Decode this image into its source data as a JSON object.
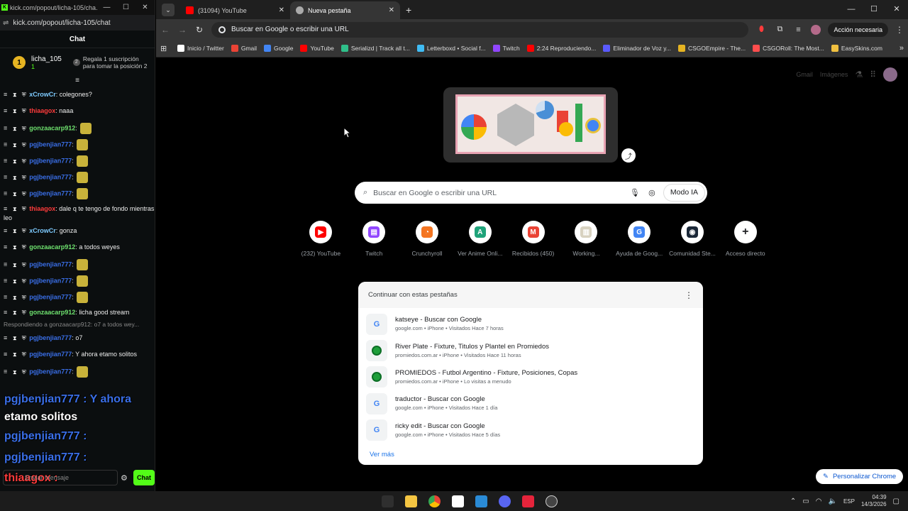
{
  "chat_window": {
    "title_url": "kick.com/popout/licha-105/cha...",
    "address": "kick.com/popout/licha-105/chat",
    "heading": "Chat",
    "pinned": {
      "rank": "1",
      "user": "licha_105",
      "count": "1",
      "gift_text_1": "Regala 1 suscripción",
      "gift_text_2": "para tomar la posición 2"
    },
    "messages": [
      {
        "user": "xCrowCr",
        "color": "#7ecbff",
        "text": "colegones?"
      },
      {
        "user": "thiaagox",
        "color": "#ff3b3b",
        "text": "naaa"
      },
      {
        "user": "gonzaacarp912",
        "color": "#6fe36f",
        "text": ""
      },
      {
        "user": "pgjbenjian777",
        "color": "#3a6fe8",
        "text": ""
      },
      {
        "user": "pgjbenjian777",
        "color": "#3a6fe8",
        "text": ""
      },
      {
        "user": "pgjbenjian777",
        "color": "#3a6fe8",
        "text": ""
      },
      {
        "user": "pgjbenjian777",
        "color": "#3a6fe8",
        "text": ""
      },
      {
        "user": "thiaagox",
        "color": "#ff3b3b",
        "text": "dale q te tengo de fondo mientras leo"
      },
      {
        "user": "xCrowCr",
        "color": "#7ecbff",
        "text": "gonza"
      },
      {
        "user": "gonzaacarp912",
        "color": "#6fe36f",
        "text": "a todos weyes"
      },
      {
        "user": "pgjbenjian777",
        "color": "#3a6fe8",
        "text": ""
      },
      {
        "user": "pgjbenjian777",
        "color": "#3a6fe8",
        "text": ""
      },
      {
        "user": "pgjbenjian777",
        "color": "#3a6fe8",
        "text": ""
      },
      {
        "user": "gonzaacarp912",
        "color": "#6fe36f",
        "text": "licha good stream"
      }
    ],
    "reply_note": "Respondiendo a gonzaacarp912: o7 a todos wey...",
    "messages_after": [
      {
        "user": "pgjbenjian777",
        "color": "#3a6fe8",
        "text": "o7"
      },
      {
        "user": "pgjbenjian777",
        "color": "#3a6fe8",
        "text": "Y ahora etamo solitos"
      },
      {
        "user": "pgjbenjian777",
        "color": "#3a6fe8",
        "text": ""
      }
    ],
    "overlay_1": "pgjbenjian777 : Y ahora",
    "overlay_2": "etamo solitos",
    "overlay_3": "pgjbenjian777 :",
    "overlay_4": "pgjbenjian777 :",
    "overlay_5": "thiaagox :",
    "input_placeholder": "Enviar mensaje",
    "send_label": "Chat"
  },
  "chrome": {
    "tabs": [
      {
        "title": "(31094) YouTube",
        "icon": "youtube-icon"
      },
      {
        "title": "Nueva pestaña",
        "icon": "chrome-icon"
      }
    ],
    "omnibox_text": "Buscar en Google o escribir una URL",
    "action_button": "Acción necesaria",
    "bookmarks": [
      {
        "label": "Inicio / Twitter",
        "color": "#ffffff"
      },
      {
        "label": "Gmail",
        "color": "#ea4335"
      },
      {
        "label": "Google",
        "color": "#4285f4"
      },
      {
        "label": "YouTube",
        "color": "#ff0000"
      },
      {
        "label": "Serializd | Track all t...",
        "color": "#2fbf8a"
      },
      {
        "label": "Letterboxd • Social f...",
        "color": "#40bcf4"
      },
      {
        "label": "Twitch",
        "color": "#9146ff"
      },
      {
        "label": "2:24 Reproduciendo...",
        "color": "#ff0000"
      },
      {
        "label": "Eliminador de Voz y...",
        "color": "#5a5aff"
      },
      {
        "label": "CSGOEmpire - The...",
        "color": "#e6b422"
      },
      {
        "label": "CSGORoll: The Most...",
        "color": "#ff4d4d"
      },
      {
        "label": "EasySkins.com",
        "color": "#f0c040"
      }
    ],
    "top_links": {
      "gmail": "Gmail",
      "images": "Imágenes"
    },
    "search_placeholder": "Buscar en Google o escribir una URL",
    "ai_mode": "Modo IA",
    "shortcuts": [
      {
        "label": "(232) YouTube",
        "color": "#ff0000",
        "glyph": "▶"
      },
      {
        "label": "Twitch",
        "color": "#9146ff",
        "glyph": "▤"
      },
      {
        "label": "Crunchyroll",
        "color": "#f47521",
        "glyph": "◔"
      },
      {
        "label": "Ver Anime Onli...",
        "color": "#1fa37a",
        "glyph": "A"
      },
      {
        "label": "Recibidos (450)",
        "color": "#ea4335",
        "glyph": "M"
      },
      {
        "label": "Working...",
        "color": "#d8d2c0",
        "glyph": "▥"
      },
      {
        "label": "Ayuda de Goog...",
        "color": "#4285f4",
        "glyph": "G"
      },
      {
        "label": "Comunidad Ste...",
        "color": "#1b2838",
        "glyph": "◉"
      },
      {
        "label": "Acceso directo",
        "color": "#ffffff",
        "glyph": "+"
      }
    ],
    "tab_card": {
      "title": "Continuar con estas pestañas",
      "items": [
        {
          "title": "katseye - Buscar con Google",
          "meta": "google.com • iPhone • Visitados Hace 7 horas",
          "type": "g"
        },
        {
          "title": "River Plate - Fixture, Titulos y Plantel en Promiedos",
          "meta": "promiedos.com.ar • iPhone • Visitados Hace 11 horas",
          "type": "p"
        },
        {
          "title": "PROMIEDOS - Futbol Argentino - Fixture, Posiciones, Copas",
          "meta": "promiedos.com.ar • iPhone • Lo visitas a menudo",
          "type": "p"
        },
        {
          "title": "traductor - Buscar con Google",
          "meta": "google.com • iPhone • Visitados Hace 1 día",
          "type": "g"
        },
        {
          "title": "ricky edit - Buscar con Google",
          "meta": "google.com • iPhone • Visitados Hace 5 días",
          "type": "g"
        }
      ],
      "more": "Ver más"
    },
    "customize": "Personalizar Chrome"
  },
  "taskbar": {
    "lang": "ESP",
    "time": "04:39",
    "date": "14/3/2026"
  }
}
